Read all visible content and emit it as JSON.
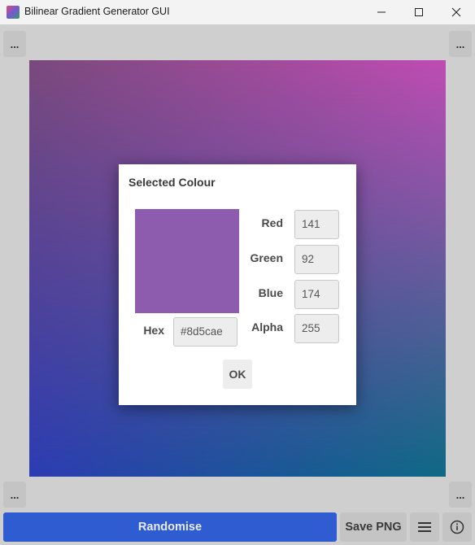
{
  "window": {
    "title": "Bilinear Gradient Generator GUI",
    "icons": [
      "app-icon",
      "minimize-icon",
      "maximize-icon",
      "close-icon"
    ]
  },
  "corners": {
    "top_left_label": "...",
    "top_right_label": "...",
    "bottom_left_label": "...",
    "bottom_right_label": "..."
  },
  "gradient_colors": {
    "top_left": "#7a4a7c",
    "top_right": "#c04cb4",
    "bottom_left": "#2c3cb2",
    "bottom_right": "#0d6a84"
  },
  "dialog": {
    "title": "Selected Colour",
    "swatch_color": "#8d5cae",
    "fields": {
      "red_label": "Red",
      "red_value": "141",
      "green_label": "Green",
      "green_value": "92",
      "blue_label": "Blue",
      "blue_value": "174",
      "alpha_label": "Alpha",
      "alpha_value": "255",
      "hex_label": "Hex",
      "hex_value": "#8d5cae"
    },
    "ok_label": "OK"
  },
  "toolbar": {
    "randomise_label": "Randomise",
    "save_label": "Save PNG",
    "menu_icon": "hamburger-menu-icon",
    "info_icon": "info-icon",
    "accent_color": "#2f5cd0"
  }
}
